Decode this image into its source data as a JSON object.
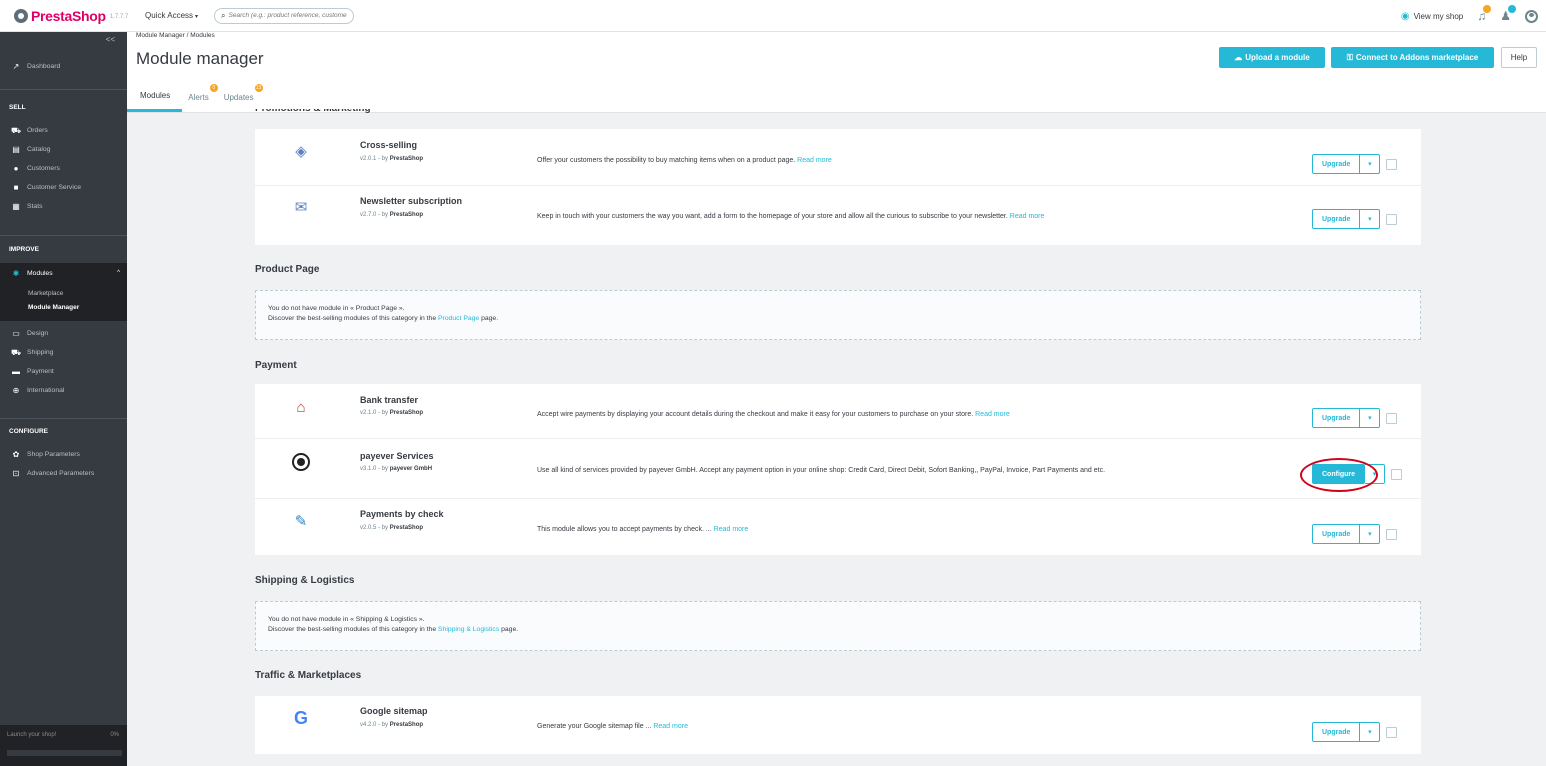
{
  "header": {
    "brand": "PrestaShop",
    "version": "1.7.7.7",
    "quick_access": "Quick Access",
    "search_placeholder": "Search (e.g.: product reference, custome",
    "view_shop": "View my shop"
  },
  "sidebar": {
    "collapse": "<<",
    "dashboard": "Dashboard",
    "sell_heading": "SELL",
    "sell_items": [
      "Orders",
      "Catalog",
      "Customers",
      "Customer Service",
      "Stats"
    ],
    "improve_heading": "IMPROVE",
    "modules": "Modules",
    "modules_sub": [
      "Marketplace",
      "Module Manager"
    ],
    "improve_items": [
      "Design",
      "Shipping",
      "Payment",
      "International"
    ],
    "configure_heading": "CONFIGURE",
    "configure_items": [
      "Shop Parameters",
      "Advanced Parameters"
    ],
    "launch_label": "Launch your shop!",
    "launch_progress": "0%"
  },
  "page": {
    "breadcrumb": "Module Manager  /  Modules",
    "title": "Module manager",
    "upload_button": "Upload a module",
    "connect_button": "Connect to Addons marketplace",
    "help_button": "Help",
    "tabs": [
      "Modules",
      "Alerts",
      "Updates"
    ],
    "alerts_badge": "0",
    "updates_badge": "13"
  },
  "sections": {
    "cut_heading": "Promotions & Marketing",
    "cross_selling": {
      "name": "Cross-selling",
      "version": "v2.0.1 - by ",
      "author": "PrestaShop",
      "description": "Offer your customers the possibility to buy matching items when on a product page. ",
      "read_more": "Read more",
      "action": "Upgrade"
    },
    "newsletter": {
      "name": "Newsletter subscription",
      "version": "v2.7.0 - by ",
      "author": "PrestaShop",
      "description": "Keep in touch with your customers the way you want, add a form to the homepage of your store and allow all the curious to subscribe to your newsletter. ",
      "read_more": "Read more",
      "action": "Upgrade"
    },
    "product_page": {
      "title": "Product Page",
      "empty_line1": "You do not have module in « Product Page ».",
      "empty_line2_pre": "Discover the best-selling modules of this category in the ",
      "empty_link": "Product Page",
      "empty_line2_post": " page."
    },
    "payment": {
      "title": "Payment",
      "bank_transfer": {
        "name": "Bank transfer",
        "version": "v2.1.0 - by ",
        "author": "PrestaShop",
        "description": "Accept wire payments by displaying your account details during the checkout and make it easy for your customers to purchase on your store. ",
        "read_more": "Read more",
        "action": "Upgrade"
      },
      "payever": {
        "name": "payever Services",
        "version": "v3.1.0 - by ",
        "author": "payever GmbH",
        "description": "Use all kind of services provided by payever GmbH. Accept any payment option in your online shop: Credit Card, Direct Debit, Sofort Banking,, PayPal, Invoice, Part Payments and etc.",
        "action": "Configure"
      },
      "check": {
        "name": "Payments by check",
        "version": "v2.0.5 - by ",
        "author": "PrestaShop",
        "description": "This module allows you to accept payments by check. ... ",
        "read_more": "Read more",
        "action": "Upgrade"
      }
    },
    "shipping": {
      "title": "Shipping & Logistics",
      "empty_line1": "You do not have module in « Shipping & Logistics ».",
      "empty_line2_pre": "Discover the best-selling modules of this category in the ",
      "empty_link": "Shipping & Logistics",
      "empty_line2_post": " page."
    },
    "traffic": {
      "title": "Traffic & Marketplaces",
      "sitemap": {
        "name": "Google sitemap",
        "version": "v4.2.0 - by ",
        "author": "PrestaShop",
        "description": "Generate your Google sitemap file ... ",
        "read_more": "Read more",
        "action": "Upgrade"
      }
    }
  },
  "icons": {
    "dropdown": "▾",
    "colors": {
      "accent": "#25b9d7",
      "sidebar": "#363a41",
      "highlight": "#d0021b",
      "brand": "#df0067"
    }
  }
}
